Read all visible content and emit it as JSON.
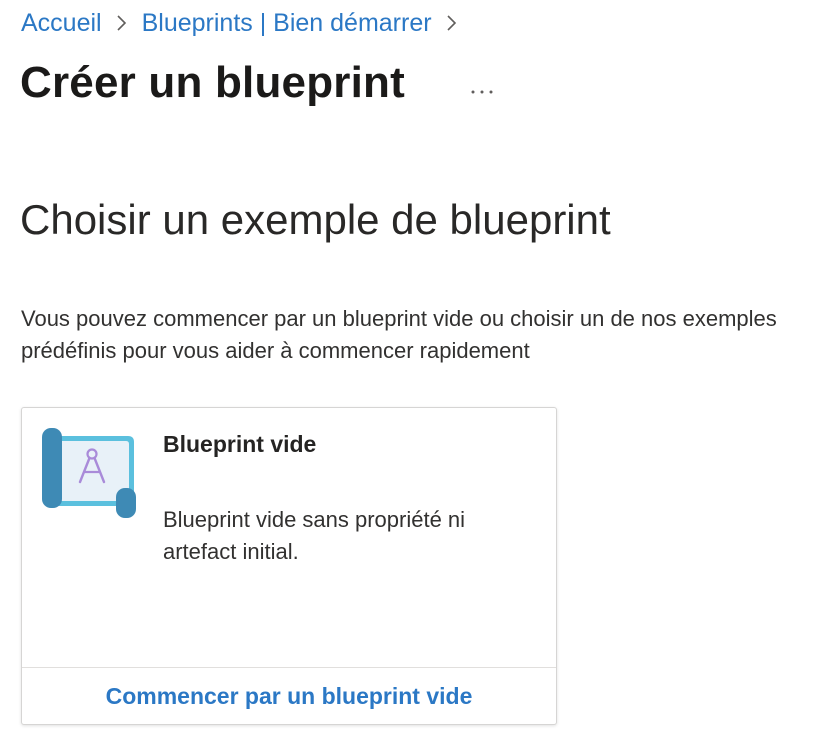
{
  "breadcrumb": {
    "items": [
      "Accueil",
      "Blueprints | Bien démarrer"
    ]
  },
  "page": {
    "title": "Créer un blueprint",
    "more_label": "···"
  },
  "section": {
    "title": "Choisir un exemple de blueprint",
    "description": "Vous pouvez commencer par un blueprint vide ou choisir un de nos exemples prédéfinis pour vous aider à commencer rapidement"
  },
  "card": {
    "icon": "blueprint-scroll-compass-icon",
    "title": "Blueprint vide",
    "description": "Blueprint vide sans propriété ni artefact initial.",
    "action_label": "Commencer par un blueprint vide"
  },
  "colors": {
    "link": "#2b78c5",
    "icon_scroll_dark": "#3e8ab5",
    "icon_scroll_light": "#5bc0de",
    "icon_compass": "#a98bd9"
  }
}
